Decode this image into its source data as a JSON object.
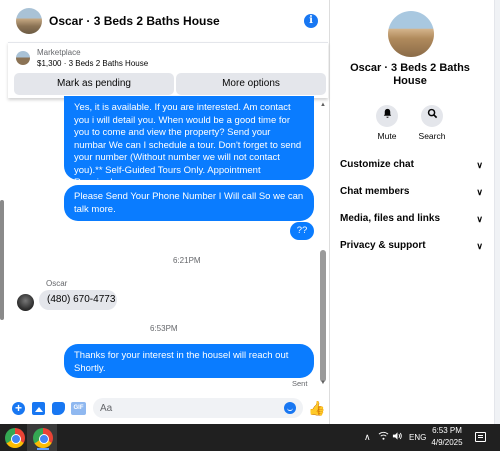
{
  "header": {
    "title": "Oscar · 3 Beds 2 Baths House",
    "info_icon": "info-icon"
  },
  "listing": {
    "source": "Marketplace",
    "price_title": "$1,300 · 3 Beds 2 Baths House",
    "mark_pending_label": "Mark as pending",
    "more_options_label": "More options"
  },
  "messages": {
    "outgoing_1": "Yes, it is available. If you are interested.  Am contact you i will detail you.  When would be a good time for you to come and view the property? Send your numbar We can I schedule a tour.  Don't forget to send your number (Without number we will not contact you).** Self-Guided Tours Only. Appointment Required.",
    "outgoing_2": "Please Send Your Phone Number I Will call So we can talk more.",
    "outgoing_3": "??",
    "timestamp_1": "6:21PM",
    "sender_name": "Oscar",
    "incoming_1": "(480) 670-4773",
    "timestamp_2": "6:53PM",
    "outgoing_4": "Thanks for your interest in the housel will reach out Shortly.",
    "sent_status": "Sent"
  },
  "composer": {
    "placeholder": "Aa",
    "gif_label": "GIF"
  },
  "info_panel": {
    "name": "Oscar · 3 Beds 2 Baths House",
    "actions": [
      {
        "label": "Mute",
        "icon": "bell-icon"
      },
      {
        "label": "Search",
        "icon": "search-icon"
      }
    ],
    "sections": [
      {
        "label": "Customize chat"
      },
      {
        "label": "Chat members"
      },
      {
        "label": "Media, files and links"
      },
      {
        "label": "Privacy & support"
      }
    ]
  },
  "taskbar": {
    "language": "ENG",
    "time": "6:53 PM",
    "date": "4/9/2025"
  },
  "colors": {
    "accent": "#0a7cff",
    "incoming_bubble": "#e4e6eb",
    "taskbar": "#202020"
  }
}
